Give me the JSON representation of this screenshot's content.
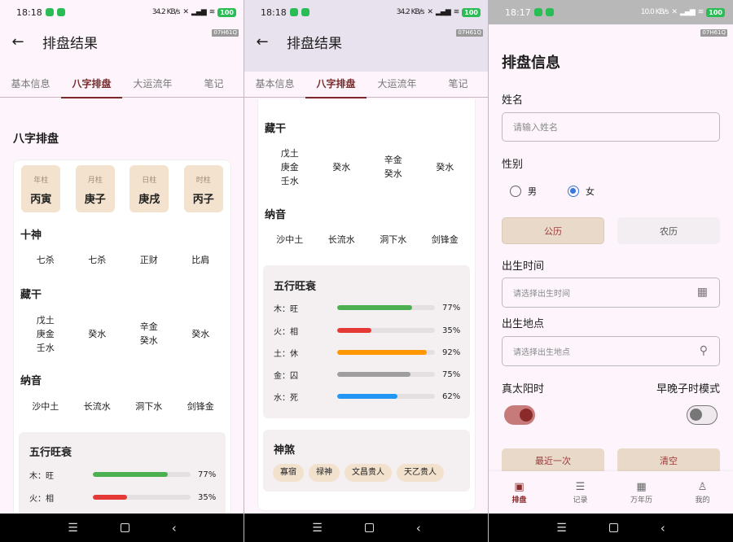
{
  "status": {
    "left_time": "18:18",
    "middle_time": "18:18",
    "right_time": "18:17",
    "speed": "34.2 KB/s",
    "speed_right": "10.0 KB/s",
    "battery": "100"
  },
  "result": {
    "title": "排盘结果",
    "tag": "07H61Q",
    "tabs": [
      "基本信息",
      "八字排盘",
      "大运流年",
      "笔记"
    ],
    "active_tab": 1,
    "section_title": "八字排盘",
    "pillars": [
      {
        "label": "年柱",
        "value": "丙寅"
      },
      {
        "label": "月柱",
        "value": "庚子"
      },
      {
        "label": "日柱",
        "value": "庚戌"
      },
      {
        "label": "时柱",
        "value": "丙子"
      }
    ],
    "shishen_title": "十神",
    "shishen": [
      "七杀",
      "七杀",
      "正财",
      "比肩"
    ],
    "canggan_title": "藏干",
    "canggan": [
      [
        "戊土",
        "庚金",
        "壬水"
      ],
      [
        "癸水"
      ],
      [
        "辛金",
        "癸水"
      ],
      [
        "癸水"
      ]
    ],
    "nayin_title": "纳音",
    "nayin": [
      "沙中土",
      "长流水",
      "洞下水",
      "剑锋金"
    ],
    "wuxing_title": "五行旺衰",
    "wuxing": [
      {
        "label": "木：旺",
        "value": 77,
        "pct": "77%",
        "color": "#4caf50"
      },
      {
        "label": "火：相",
        "value": 35,
        "pct": "35%",
        "color": "#e53935"
      },
      {
        "label": "土：休",
        "value": 92,
        "pct": "92%",
        "color": "#ff9800"
      },
      {
        "label": "金：囚",
        "value": 75,
        "pct": "75%",
        "color": "#9e9e9e"
      },
      {
        "label": "水：死",
        "value": 62,
        "pct": "62%",
        "color": "#2196f3"
      }
    ],
    "shensha_title": "神煞",
    "shensha": [
      "寡宿",
      "禄神",
      "文昌贵人",
      "天乙贵人"
    ]
  },
  "form": {
    "title": "排盘信息",
    "tag": "07H61Q",
    "name_label": "姓名",
    "name_placeholder": "请输入姓名",
    "gender_label": "性别",
    "male": "男",
    "female": "女",
    "gender_selected": "女",
    "calendar_solar": "公历",
    "calendar_lunar": "农历",
    "calendar_selected": "公历",
    "birth_time_label": "出生时间",
    "birth_time_placeholder": "请选择出生时间",
    "birth_place_label": "出生地点",
    "birth_place_placeholder": "请选择出生地点",
    "true_solar_label": "真太阳时",
    "true_solar_on": true,
    "zi_mode_label": "早晚子时模式",
    "zi_mode_on": false,
    "recent_button": "最近一次",
    "clear_button": "清空",
    "nav": [
      {
        "label": "排盘",
        "icon": "calendar-icon",
        "active": true
      },
      {
        "label": "记录",
        "icon": "list-icon",
        "active": false
      },
      {
        "label": "万年历",
        "icon": "calendar-grid-icon",
        "active": false
      },
      {
        "label": "我的",
        "icon": "person-icon",
        "active": false
      }
    ]
  },
  "colors": {
    "accent": "#7a2a2a",
    "pillar_bg": "#f3e2cd",
    "toggle_on": "#c77a7a",
    "radio_selected": "#3a78d8"
  }
}
